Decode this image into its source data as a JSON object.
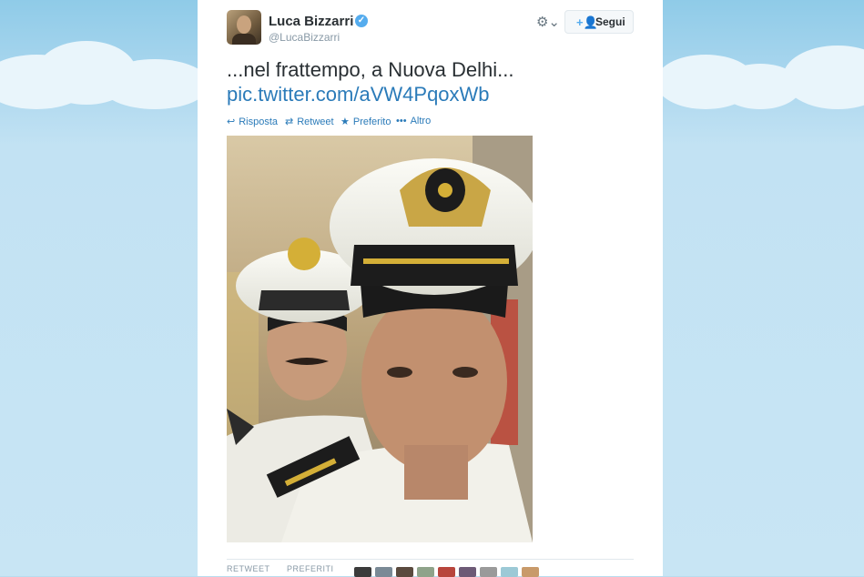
{
  "author": {
    "name": "Luca Bizzarri",
    "handle": "@LucaBizzarri",
    "verified_mark": "✓"
  },
  "header": {
    "gear_icon": "⚙⌄",
    "follow_icon": "+👤",
    "follow_label": "Segui"
  },
  "tweet": {
    "text": "...nel frattempo, a Nuova Delhi...",
    "link": "pic.twitter.com/aVW4PqoxWb"
  },
  "actions": {
    "reply_icon": "↩",
    "reply_label": "Risposta",
    "retweet_icon": "⇄",
    "retweet_label": "Retweet",
    "favorite_icon": "★",
    "favorite_label": "Preferito",
    "more_icon": "•••",
    "more_label": "Altro"
  },
  "stats": {
    "retweets_label": "RETWEET",
    "favorites_label": "PREFERITI"
  },
  "colors": {
    "link": "#2b7bb9",
    "verified": "#55acee",
    "text": "#292f33",
    "muted": "#8899a6"
  }
}
